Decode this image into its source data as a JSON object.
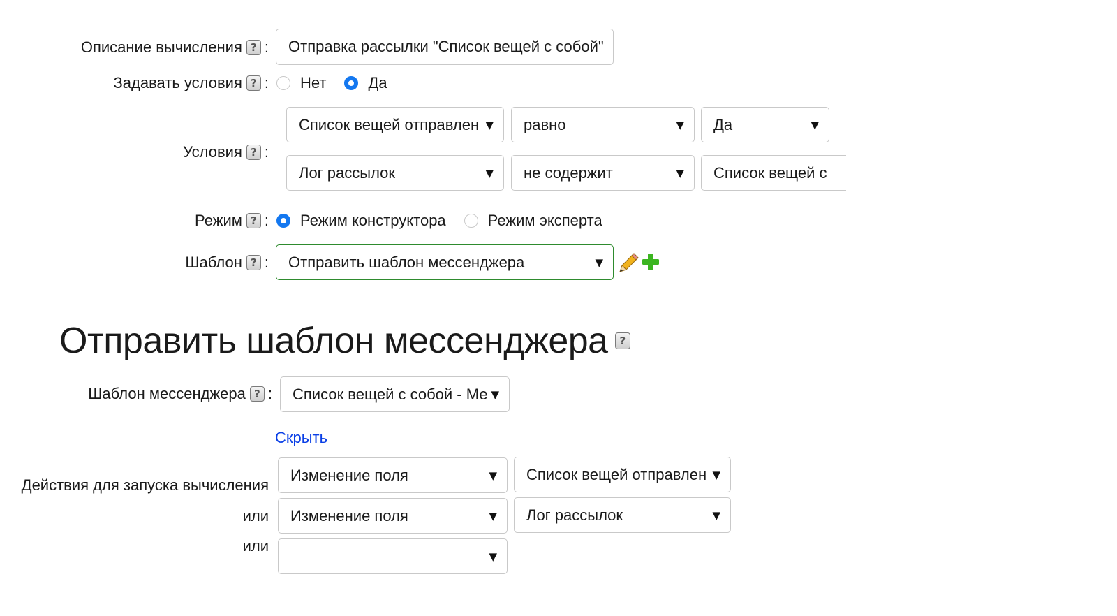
{
  "form": {
    "description": {
      "label": "Описание вычисления",
      "value": "Отправка рассылки \"Список вещей с собой\""
    },
    "set_conditions": {
      "label": "Задавать условия",
      "options": [
        "Нет",
        "Да"
      ],
      "selected": "Да"
    },
    "conditions": {
      "label": "Условия",
      "rows": [
        {
          "field": "Список вещей отправлен",
          "operator": "равно",
          "value": "Да"
        },
        {
          "field": "Лог рассылок",
          "operator": "не содержит",
          "value": "Список вещей с"
        }
      ]
    },
    "mode": {
      "label": "Режим",
      "options": [
        "Режим конструктора",
        "Режим эксперта"
      ],
      "selected": "Режим конструктора"
    },
    "template": {
      "label": "Шаблон",
      "value": "Отправить шаблон мессенджера"
    }
  },
  "section": {
    "title": "Отправить шаблон мессенджера",
    "messenger_template": {
      "label": "Шаблон мессенджера",
      "value": "Список вещей с собой - Мессенджер"
    },
    "hide_link": "Скрыть",
    "triggers": {
      "label": "Действия для запуска вычисления",
      "or_label": "или",
      "rows": [
        {
          "action": "Изменение поля",
          "field": "Список вещей отправлен"
        },
        {
          "action": "Изменение поля",
          "field": "Лог рассылок"
        },
        {
          "action": "",
          "field": null
        }
      ]
    }
  },
  "colors": {
    "accent": "#1478f0",
    "link": "#0a3fe6",
    "selected_border": "#2e8b2e",
    "add_icon": "#3cb521"
  },
  "icons": [
    "help-icon",
    "pencil-icon",
    "plus-icon",
    "caret-down-icon"
  ]
}
